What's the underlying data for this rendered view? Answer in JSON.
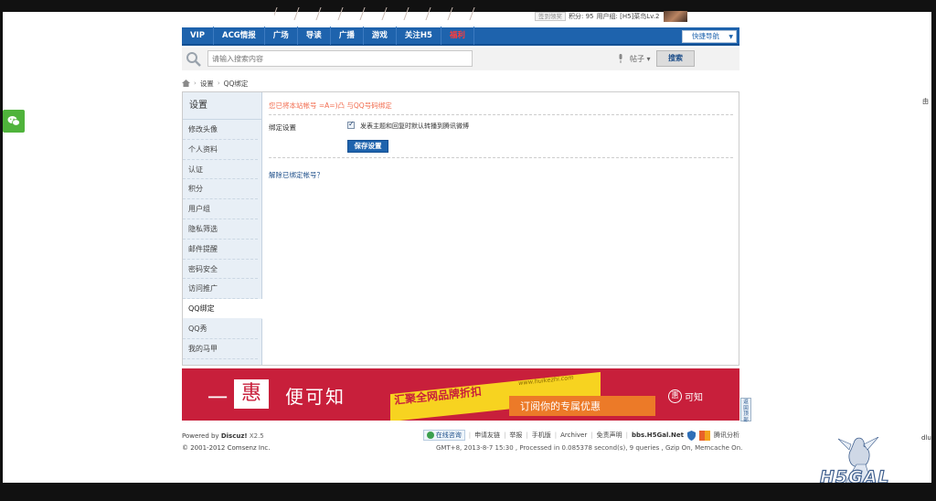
{
  "userbar": {
    "checkin_label": "签到领奖",
    "points_label": "积分: 95",
    "user_label": "用户组: [H5]菜鸟Lv.2"
  },
  "nav": {
    "items": [
      {
        "label": "VIP",
        "hot": false
      },
      {
        "label": "ACG情报",
        "hot": false
      },
      {
        "label": "广场",
        "hot": false
      },
      {
        "label": "导读",
        "hot": false
      },
      {
        "label": "广播",
        "hot": false
      },
      {
        "label": "游戏",
        "hot": false
      },
      {
        "label": "关注H5",
        "hot": false
      },
      {
        "label": "福利",
        "hot": true
      }
    ],
    "quicknav_label": "快捷导航"
  },
  "search": {
    "placeholder": "请输入搜索内容",
    "type_label": "帖子",
    "button_label": "搜索"
  },
  "breadcrumb": {
    "items": [
      "设置",
      "QQ绑定"
    ]
  },
  "sidebar": {
    "title": "设置",
    "items": [
      {
        "label": "修改头像",
        "active": false
      },
      {
        "label": "个人资料",
        "active": false
      },
      {
        "label": "认证",
        "active": false
      },
      {
        "label": "积分",
        "active": false
      },
      {
        "label": "用户组",
        "active": false
      },
      {
        "label": "隐私筛选",
        "active": false
      },
      {
        "label": "邮件提醒",
        "active": false
      },
      {
        "label": "密码安全",
        "active": false
      },
      {
        "label": "访问推广",
        "active": false
      },
      {
        "label": "QQ绑定",
        "active": true
      },
      {
        "label": "QQ秀",
        "active": false
      },
      {
        "label": "我的马甲",
        "active": false
      }
    ]
  },
  "content": {
    "notice": "您已将本站帐号 =A=)凸 与QQ号码绑定",
    "bind_label": "绑定设置",
    "checkbox_checked": true,
    "checkbox_label": "发表主题和回复时默认转播到腾讯微博",
    "save_button": "保存设置",
    "unbind_link": "解除已绑定帐号？"
  },
  "ad": {
    "yi": "一",
    "hui": "惠",
    "name": "便可知",
    "slogan1": "汇聚全网品牌折扣",
    "url": "www.huikezhi.com",
    "slogan2": "订阅你的专属优惠",
    "logo_circle": "惠",
    "logo_text": "可知"
  },
  "back_top": "返回顶部",
  "footer": {
    "powered_prefix": "Powered by",
    "powered_name": "Discuz!",
    "version": "X2.5",
    "copyright": "© 2001-2012 Comsenz Inc.",
    "consult": "在线咨询",
    "links": [
      "申请友链",
      "举报",
      "手机版",
      "Archiver",
      "免责声明"
    ],
    "bbs": "bbs.H5Gal.Net",
    "stats": "腾讯分析",
    "processed": "GMT+8, 2013-8-7 15:30 , Processed in 0.085378 second(s), 9 queries , Gzip On, Memcache On."
  },
  "edge": {
    "top": "由",
    "bottom": "dlu"
  },
  "watermark": "H5GAL",
  "colors": {
    "nav_blue": "#1e63ad",
    "notice_orange": "#f26c4f",
    "ad_red": "#c81f3b",
    "wechat_green": "#4fb33b"
  }
}
